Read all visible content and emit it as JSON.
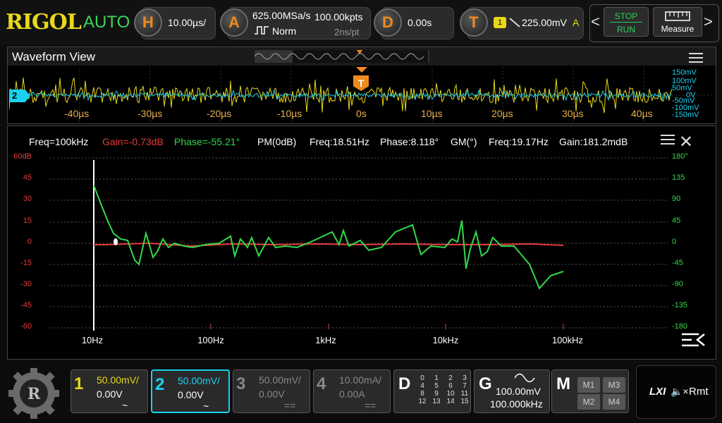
{
  "app": {
    "brand": "RIGOL",
    "trigger_mode": "AUTO"
  },
  "horizontal": {
    "icon": "H",
    "timebase": "10.00µs/"
  },
  "acquire": {
    "icon": "A",
    "sample_rate": "625.00MSa/s",
    "mem_depth": "100.00kpts",
    "mode": "Norm",
    "resolution": "2ns/pt"
  },
  "delay": {
    "icon": "D",
    "value": "0.00s"
  },
  "trigger": {
    "icon": "T",
    "source": "1",
    "level": "225.00mV",
    "state": "A"
  },
  "controls": {
    "stop": "STOP",
    "run": "RUN",
    "measure": "Measure",
    "prev": "<",
    "next": ">"
  },
  "waveform_view": {
    "title": "Waveform View",
    "channel_marker": "2",
    "time_ticks": [
      "-40µs",
      "-30µs",
      "-20µs",
      "-10µs",
      "0s",
      "10µs",
      "20µs",
      "30µs",
      "40µs"
    ],
    "volt_ticks": [
      "150mV",
      "100mV",
      "50mV",
      "0V",
      "-50mV",
      "-100mV",
      "-150mV"
    ],
    "trigger_marker": "T"
  },
  "bode": {
    "meas": {
      "freq": "Freq=100kHz",
      "gain": "Gain=-0.73dB",
      "phase": "Phase=-55.21°",
      "pm": "PM(0dB)",
      "pm_freq": "Freq:18.51Hz",
      "pm_phase": "Phase:8.118°",
      "gm": "GM(°)",
      "gm_freq": "Freq:19.17Hz",
      "gm_gain": "Gain:181.2mdB"
    },
    "gain_axis": [
      "60dB",
      "45",
      "30",
      "15",
      "0",
      "-15",
      "-30",
      "-45",
      "-60"
    ],
    "phase_axis": [
      "180°",
      "135",
      "90",
      "45",
      "0",
      "-45",
      "-90",
      "-135",
      "-180"
    ],
    "freq_axis": [
      "10Hz",
      "100Hz",
      "1kHz",
      "10kHz",
      "100kHz"
    ],
    "colors": {
      "gain": "#e53a3a",
      "phase": "#32d94a"
    }
  },
  "channels": [
    {
      "num": "1",
      "scale": "50.00mV/",
      "offset": "0.00V",
      "coupling": "~",
      "color": "#e8d81a",
      "active": true
    },
    {
      "num": "2",
      "scale": "50.00mV/",
      "offset": "0.00V",
      "coupling": "~",
      "color": "#18d2f0",
      "active": true,
      "selected": true
    },
    {
      "num": "3",
      "scale": "50.00mV/",
      "offset": "0.00V",
      "coupling": "==",
      "color": "#888888",
      "active": false
    },
    {
      "num": "4",
      "scale": "10.00mA/",
      "offset": "0.00A",
      "coupling": "==",
      "color": "#888888",
      "active": false
    }
  ],
  "digital": {
    "label": "D",
    "grid": [
      "0",
      "1",
      "2",
      "3",
      "4",
      "5",
      "6",
      "7",
      "8",
      "9",
      "10",
      "11",
      "12",
      "13",
      "14",
      "15"
    ]
  },
  "generator": {
    "label": "G",
    "amplitude": "100.00mV",
    "frequency": "100.000kHz"
  },
  "math": {
    "label": "M",
    "buttons": [
      "M1",
      "M3",
      "M2",
      "M4"
    ]
  },
  "status": {
    "lxi": "LXI",
    "sound": "🔈×",
    "remote": "Rmt"
  }
}
